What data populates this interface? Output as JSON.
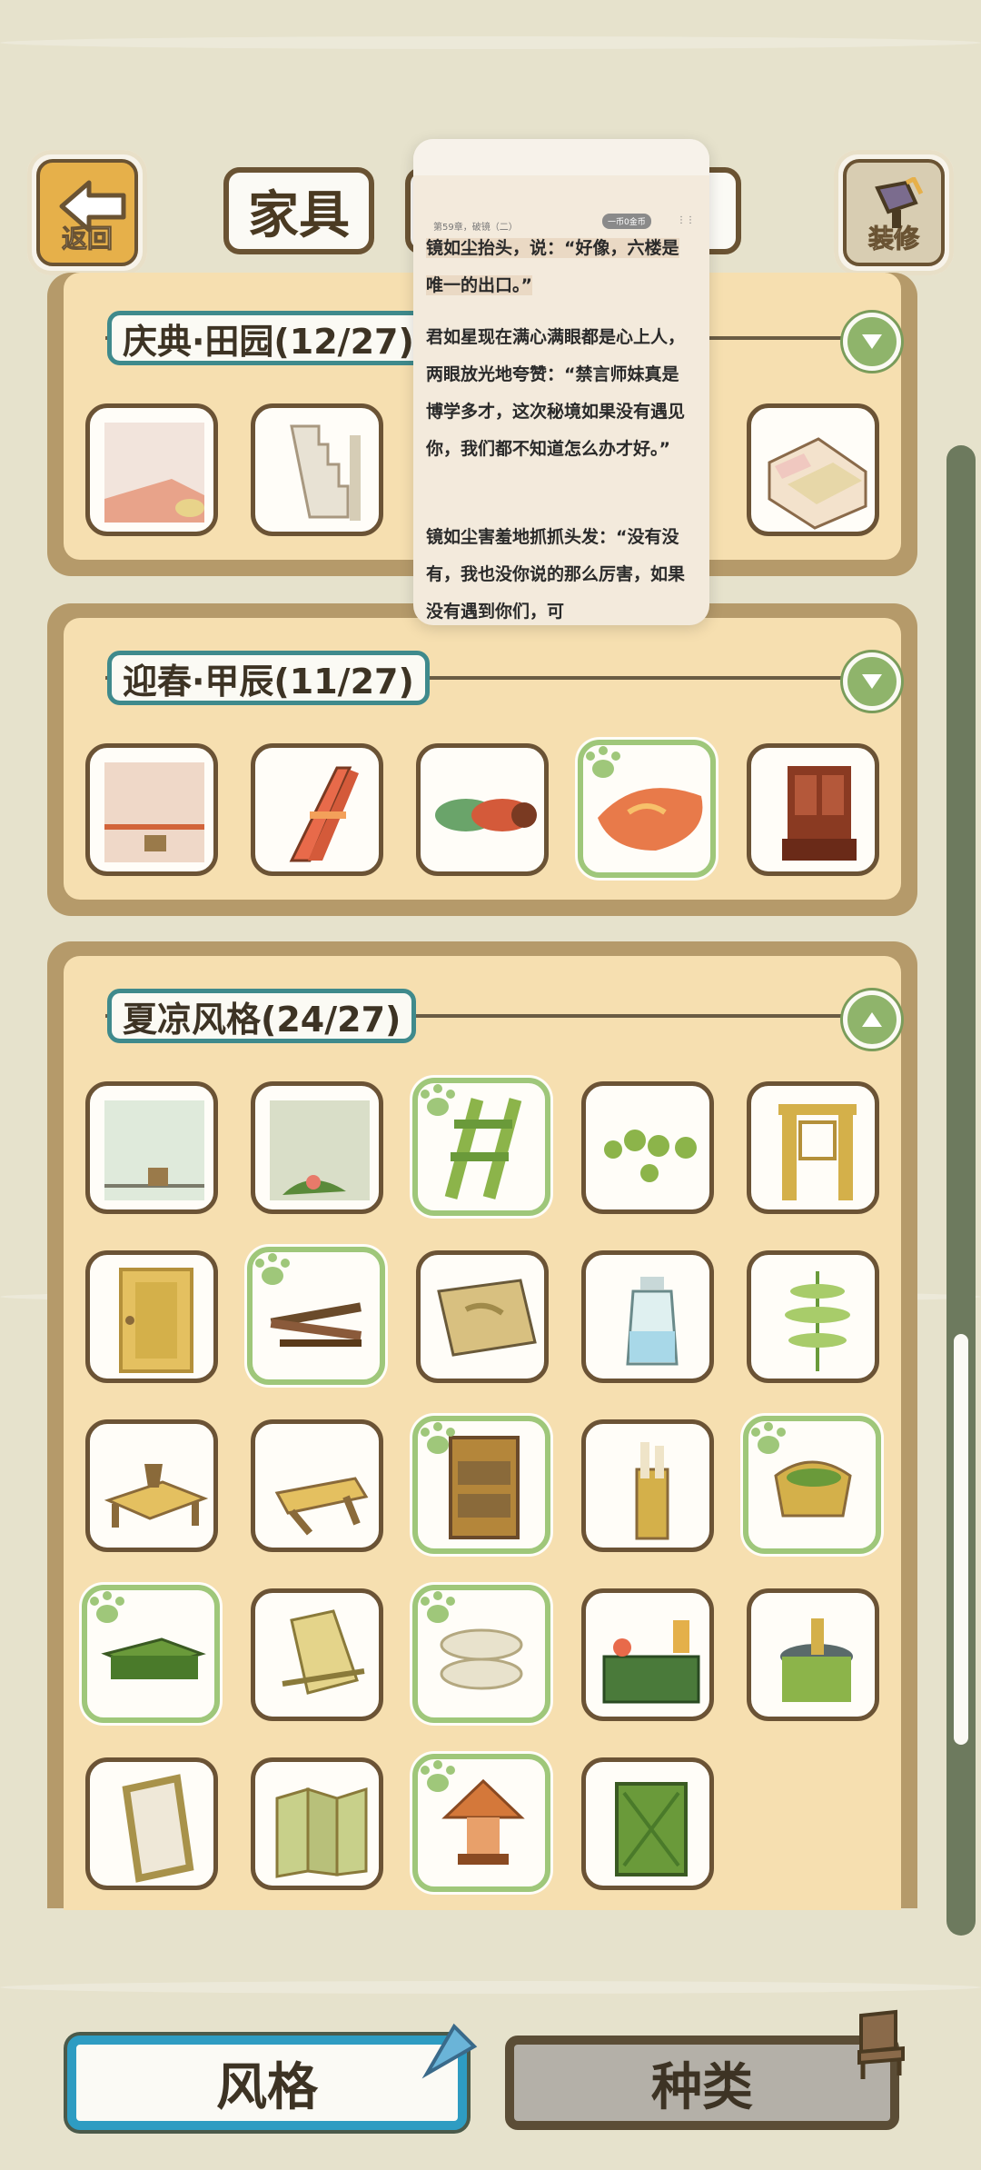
{
  "header": {
    "back_label": "返回",
    "tab_furniture": "家具",
    "decorate_label": "装修"
  },
  "panels": [
    {
      "title": "庆典·田园(12/27)"
    },
    {
      "title": "迎春·甲辰(11/27)"
    },
    {
      "title": "夏凉风格(24/27)"
    }
  ],
  "bottom": {
    "style_label": "风格",
    "kind_label": "种类"
  },
  "reader": {
    "chapter": "第59章，破镜（二）",
    "coin_label": "一币0金币",
    "p1": "镜如尘抬头，说：“好像，六楼是唯一的出口。”",
    "p2": "君如星现在满心满眼都是心上人，两眼放光地夸赞：“禁言师妹真是博学多才，这次秘境如果没有遇见你，我们都不知道怎么办才好。”",
    "p3": "镜如尘害羞地抓抓头发：“没有没有，我也没你说的那么厉害，如果没有遇到你们，可"
  },
  "colors": {
    "accent_teal": "#3f8a8c",
    "owned_green": "#9fc77a",
    "panel_bg": "#f6dfb0",
    "style_border": "#2e9cc2"
  }
}
